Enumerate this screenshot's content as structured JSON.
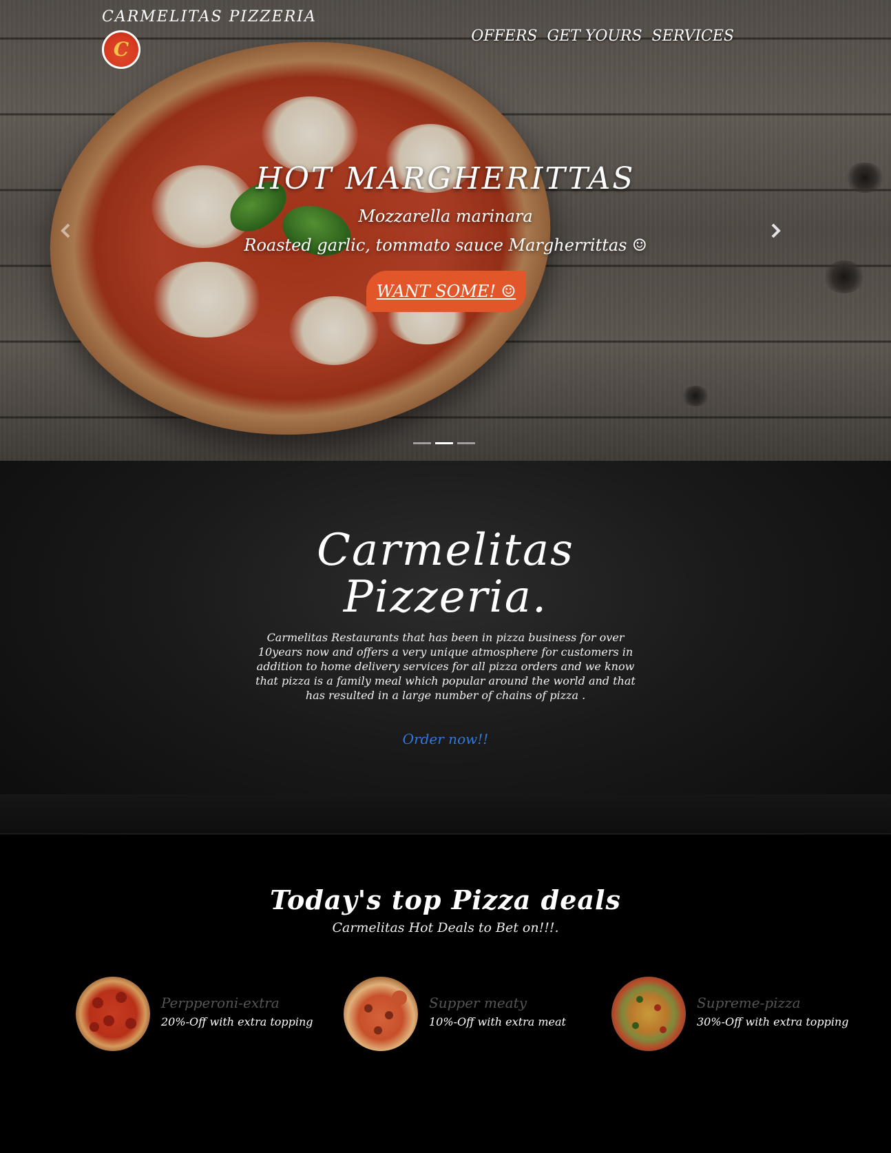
{
  "header": {
    "brand": "CARMELITAS PIZZERIA",
    "logo_letter": "C",
    "nav": [
      "OFFERS",
      "GET YOURS",
      "SERVICES"
    ]
  },
  "hero": {
    "title": "HOT MARGHERITTAS",
    "subtitle": "Mozzarella marinara",
    "description": "Roasted garlic, tommato sauce Margherrittas ☺",
    "cta": "WANT SOME! ☺",
    "prev_icon": "chevron-left-icon",
    "next_icon": "chevron-right-icon",
    "slides_count": 3,
    "active_slide": 2
  },
  "about": {
    "title_line1": "Carmelitas",
    "title_line2": "Pizzeria.",
    "text": "Carmelitas Restaurants that has been in pizza business for over 10years now and offers a very unique atmosphere for customers in addition to home delivery services for all pizza orders and we know that pizza is a family meal which popular around the world and that has resulted in a large number of chains of pizza .",
    "link": "Order now!!"
  },
  "deals": {
    "title": "Today's top Pizza deals",
    "subtitle": "Carmelitas Hot Deals to Bet on!!!.",
    "items": [
      {
        "name": "Perpperoni-extra",
        "desc": "20%-Off with extra topping"
      },
      {
        "name": "Supper meaty",
        "desc": "10%-Off with extra meat"
      },
      {
        "name": "Supreme-pizza",
        "desc": "30%-Off with extra topping"
      }
    ]
  },
  "colors": {
    "accent": "#e2572a",
    "link": "#2f7ae5",
    "background": "#000000"
  }
}
